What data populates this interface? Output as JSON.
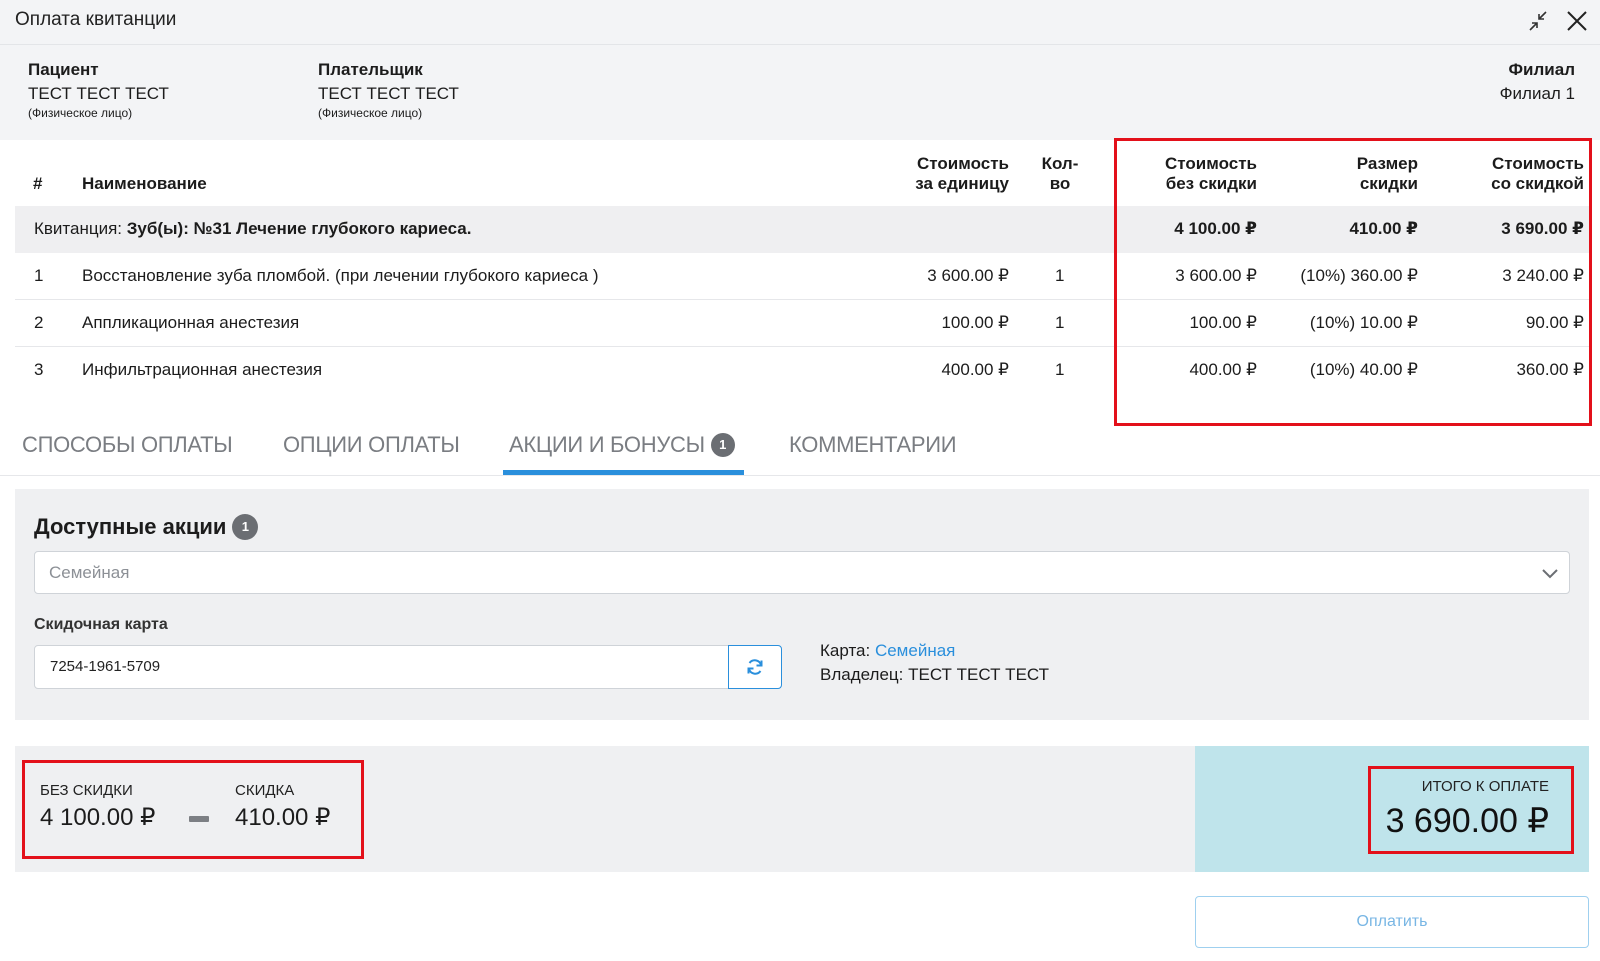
{
  "window": {
    "title": "Оплата квитанции"
  },
  "info": {
    "patient": {
      "label": "Пациент",
      "name": "ТЕСТ ТЕСТ ТЕСТ",
      "type": "(Физическое лицо)"
    },
    "payer": {
      "label": "Плательщик",
      "name": "ТЕСТ ТЕСТ ТЕСТ",
      "type": "(Физическое лицо)"
    },
    "branch": {
      "label": "Филиал",
      "name": "Филиал 1"
    }
  },
  "table": {
    "headers": {
      "num": "#",
      "name": "Наименование",
      "unit_price_1": "Стоимость",
      "unit_price_2": "за единицу",
      "qty_1": "Кол-",
      "qty_2": "во",
      "no_discount_1": "Стоимость",
      "no_discount_2": "без скидки",
      "discount_1": "Размер",
      "discount_2": "скидки",
      "with_discount_1": "Стоимость",
      "with_discount_2": "со скидкой"
    },
    "group": {
      "prefix": "Квитанция:",
      "title": "Зуб(ы): №31 Лечение глубокого кариеса.",
      "no_discount": "4 100.00 ₽",
      "discount": "410.00 ₽",
      "with_discount": "3 690.00 ₽"
    },
    "rows": [
      {
        "num": "1",
        "name": "Восстановление зуба пломбой. (при лечении глубокого кариеса )",
        "unit_price": "3 600.00 ₽",
        "qty": "1",
        "no_discount": "3 600.00 ₽",
        "discount": "(10%) 360.00 ₽",
        "with_discount": "3 240.00 ₽"
      },
      {
        "num": "2",
        "name": "Аппликационная анестезия",
        "unit_price": "100.00 ₽",
        "qty": "1",
        "no_discount": "100.00 ₽",
        "discount": "(10%) 10.00 ₽",
        "with_discount": "90.00 ₽"
      },
      {
        "num": "3",
        "name": "Инфильтрационная анестезия",
        "unit_price": "400.00 ₽",
        "qty": "1",
        "no_discount": "400.00 ₽",
        "discount": "(10%) 40.00 ₽",
        "with_discount": "360.00 ₽"
      }
    ]
  },
  "tabs": [
    {
      "label": "СПОСОБЫ ОПЛАТЫ"
    },
    {
      "label": "ОПЦИИ ОПЛАТЫ"
    },
    {
      "label": "АКЦИИ И БОНУСЫ",
      "badge": "1",
      "active": true
    },
    {
      "label": "КОММЕНТАРИИ"
    }
  ],
  "promo": {
    "title": "Доступные акции",
    "badge": "1",
    "select_value": "Семейная",
    "card_label": "Скидочная карта",
    "card_number": "7254-1961-5709",
    "card_prefix": "Карта:",
    "card_name": "Семейная",
    "owner_prefix": "Владелец:",
    "owner_name": "ТЕСТ ТЕСТ ТЕСТ"
  },
  "totals": {
    "no_discount_label": "БЕЗ СКИДКИ",
    "no_discount_value": "4 100.00 ₽",
    "discount_label": "СКИДКА",
    "discount_value": "410.00 ₽",
    "total_label": "ИТОГО К ОПЛАТЕ",
    "total_value": "3 690.00 ₽"
  },
  "pay_button": "Оплатить",
  "colors": {
    "accent": "#2a8fdc",
    "highlight": "#e3101a",
    "total_bg": "#bfe4eb"
  }
}
